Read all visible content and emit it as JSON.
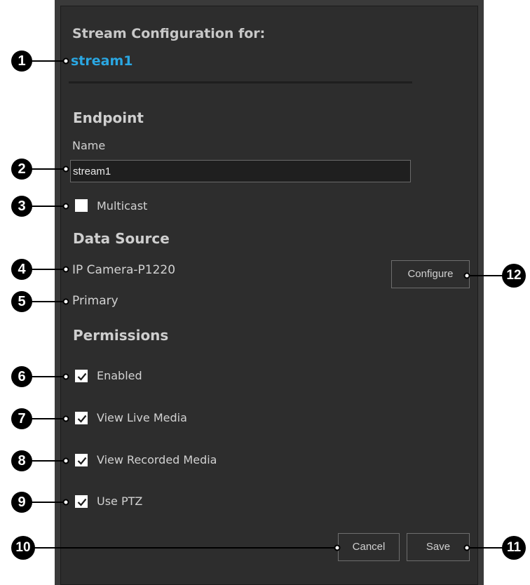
{
  "header": {
    "title": "Stream Configuration for:",
    "stream_name": "stream1"
  },
  "endpoint": {
    "section_label": "Endpoint",
    "name_label": "Name",
    "name_value": "stream1",
    "multicast_label": "Multicast",
    "multicast_checked": false
  },
  "data_source": {
    "section_label": "Data Source",
    "source": "IP Camera-P1220",
    "stream_type": "Primary",
    "configure_label": "Configure"
  },
  "permissions": {
    "section_label": "Permissions",
    "items": [
      {
        "label": "Enabled",
        "checked": true
      },
      {
        "label": "View Live Media",
        "checked": true
      },
      {
        "label": "View Recorded Media",
        "checked": true
      },
      {
        "label": "Use PTZ",
        "checked": true
      }
    ]
  },
  "footer": {
    "cancel_label": "Cancel",
    "save_label": "Save"
  },
  "callouts": [
    "1",
    "2",
    "3",
    "4",
    "5",
    "6",
    "7",
    "8",
    "9",
    "10",
    "11",
    "12"
  ],
  "colors": {
    "accent": "#2aa7e2",
    "panel_bg": "#2d2d2d",
    "frame_bg": "#3a3a3a"
  }
}
